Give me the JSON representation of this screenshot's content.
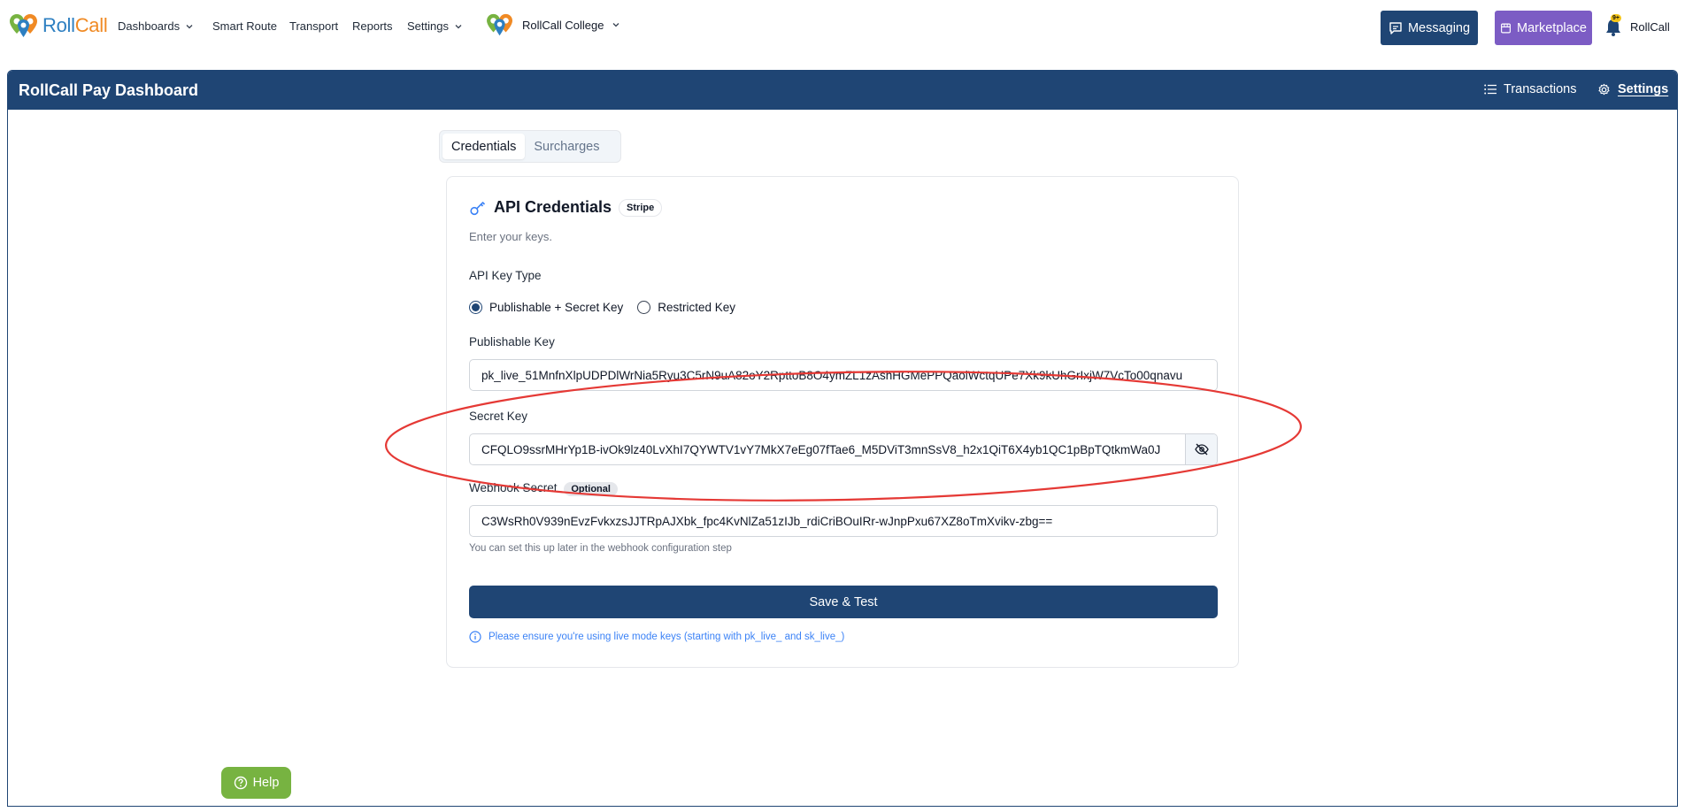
{
  "nav": {
    "brand_roll": "Roll",
    "brand_call": "Call",
    "items": [
      {
        "label": "Dashboards",
        "has_dropdown": true
      },
      {
        "label": "Smart Route",
        "has_dropdown": false
      },
      {
        "label": "Transport",
        "has_dropdown": false
      },
      {
        "label": "Reports",
        "has_dropdown": false
      },
      {
        "label": "Settings",
        "has_dropdown": true
      }
    ],
    "college": "RollCall College",
    "messaging_label": "Messaging",
    "marketplace_label": "Marketplace",
    "user_label": "RollCall",
    "notification_badge": "9+"
  },
  "dashboard": {
    "title": "RollCall Pay Dashboard",
    "transactions_label": "Transactions",
    "settings_label": "Settings"
  },
  "tabs": [
    {
      "label": "Credentials",
      "active": true
    },
    {
      "label": "Surcharges",
      "active": false
    }
  ],
  "card": {
    "title": "API Credentials",
    "badge": "Stripe",
    "description": "Enter your keys.",
    "key_type_label": "API Key Type",
    "key_type_options": [
      {
        "label": "Publishable + Secret Key",
        "selected": true
      },
      {
        "label": "Restricted Key",
        "selected": false
      }
    ],
    "publishable_label": "Publishable Key",
    "publishable_value": "pk_live_51MnfnXlpUDPDlWrNia5Ryu3C5rN9uA82oY2RpttoB8O4ymZL1zAshHGMePPQaolWctqUPe7Xk9kUhGrIxjW7VcTo00qnavu",
    "secret_label": "Secret Key",
    "secret_value": "CFQLO9ssrMHrYp1B-ivOk9lz40LvXhI7QYWTV1vY7MkX7eEg07fTae6_M5DViT3mnSsV8_h2x1QiT6X4yb1QC1pBpTQtkmWa0J",
    "webhook_label": "Webhook Secret",
    "optional_badge": "Optional",
    "webhook_value": "C3WsRh0V939nEvzFvkxzsJJTRpAJXbk_fpc4KvNlZa51zIJb_rdiCriBOuIRr-wJnpPxu67XZ8oTmXvikv-zbg==",
    "webhook_hint": "You can set this up later in the webhook configuration step",
    "save_label": "Save & Test",
    "info_text": "Please ensure you're using live mode keys (starting with pk_live_ and sk_live_)"
  },
  "help_label": "Help",
  "colors": {
    "primary": "#1f4574",
    "marketplace": "#7c5cc4",
    "help": "#77b341",
    "annotation": "#e53935",
    "info": "#3b82f6"
  }
}
